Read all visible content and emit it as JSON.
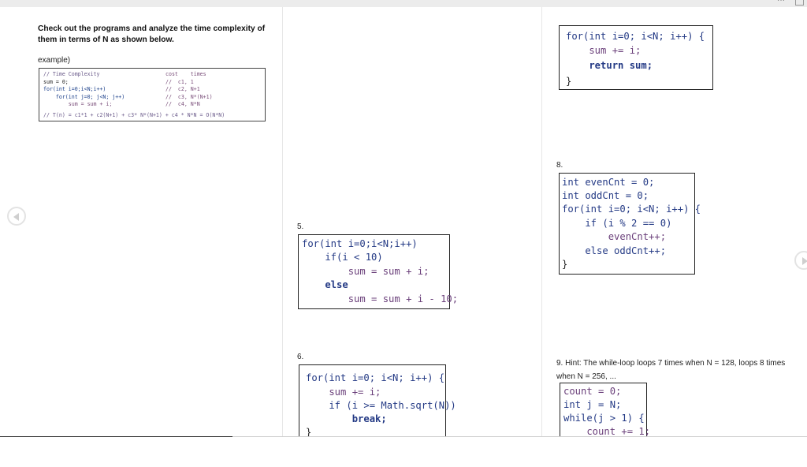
{
  "intro": "Check out the programs and analyze the time complexity of them in terms of N as shown below.",
  "example_label": "example)",
  "example": {
    "lines": [
      {
        "code": "// Time Complexity",
        "cost": "cost    times"
      },
      {
        "code": "sum = 0;",
        "cost": "//  c1, 1"
      },
      {
        "code": "for(int i=0;i<N;i++)",
        "cost": "//  c2, N+1"
      },
      {
        "code": "    for(int j=0; j<N; j++)",
        "cost": "//  c3, N*(N+1)"
      },
      {
        "code": "        sum = sum + i;",
        "cost": "//  c4, N*N"
      },
      {
        "code": "// T(n) = c1*1 + c2(N+1) + c3* N*(N+1) + c4 * N*N = O(N*N)",
        "cost": ""
      }
    ]
  },
  "problems": {
    "p4": {
      "lines": [
        "for(int i=0; i<N; i++) {",
        "    sum += i;",
        "    return sum;",
        "}"
      ]
    },
    "p5": {
      "number": "5.",
      "lines": [
        "for(int i=0;i<N;i++)",
        "    if(i < 10)",
        "        sum = sum + i;",
        "    else",
        "        sum = sum + i - 10;"
      ]
    },
    "p6": {
      "number": "6.",
      "lines": [
        "for(int i=0; i<N; i++) {",
        "    sum += i;",
        "    if (i >= Math.sqrt(N))",
        "        break;",
        "}"
      ]
    },
    "p8": {
      "number": "8.",
      "lines": [
        "int evenCnt = 0;",
        "int oddCnt = 0;",
        "for(int i=0; i<N; i++) {",
        "    if (i % 2 == 0)",
        "        evenCnt++;",
        "    else oddCnt++;",
        "}"
      ]
    },
    "p9": {
      "number": "9.",
      "hint": "Hint: The while-loop loops 7 times when N = 128, loops 8 times when N = 256, ...",
      "lines": [
        "count = 0;",
        "int j = N;",
        "while(j > 1) {",
        "    count += 1;"
      ]
    }
  }
}
